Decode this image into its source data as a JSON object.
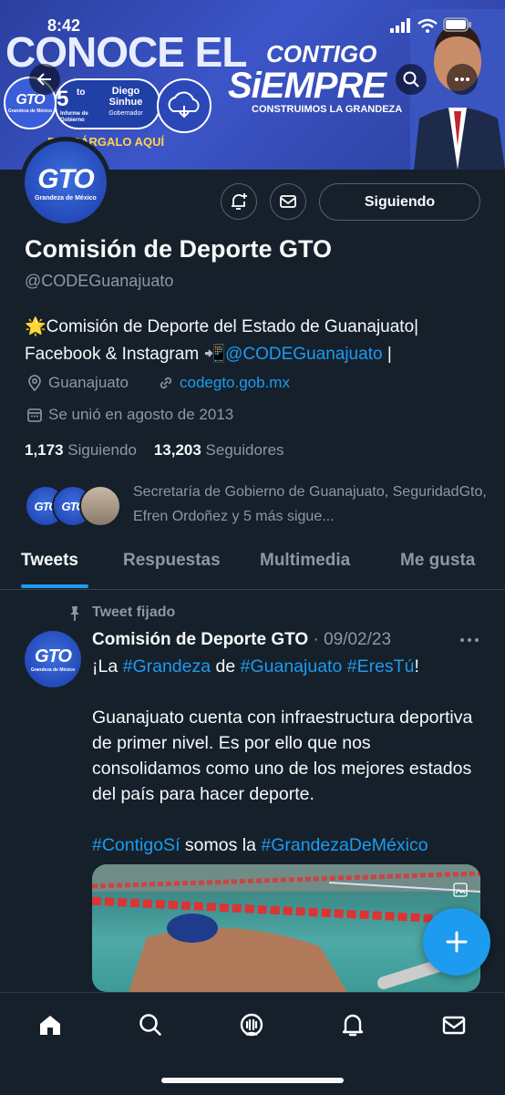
{
  "status_bar": {
    "time": "8:42"
  },
  "banner": {
    "headline": "CONOCE EL",
    "informe_number": "5",
    "informe_suffix": "to",
    "informe_label": "Informe de Gobierno",
    "informe_name": "Diego Sinhue",
    "informe_role": "Gobernador",
    "download_label": "DESCÁRGALO AQUÍ",
    "contigo": "CONTIGO",
    "siempre": "SiEMPRE",
    "construimos": "CONSTRUIMOS LA GRANDEZA",
    "logo_text": "GTO",
    "logo_sub": "Grandeza de México"
  },
  "profile": {
    "avatar_text": "GTO",
    "avatar_sub": "Grandeza de México",
    "follow_button": "Siguiendo",
    "name": "Comisión de Deporte GTO",
    "handle": "@CODEGuanajuato",
    "bio_emoji": "🌟",
    "bio_line1": "Comisión de Deporte del Estado de Guanajuato|",
    "bio_line2": "Facebook & Instagram ",
    "bio_emoji2": "📲",
    "bio_link": "@CODEGuanajuato",
    "bio_end": " |",
    "location": "Guanajuato",
    "website": "codegto.gob.mx",
    "joined": "Se unió en agosto de 2013",
    "following_count": "1,173",
    "following_label": "Siguiendo",
    "followers_count": "13,203",
    "followers_label": "Seguidores",
    "followed_by": "Secretaría de Gobierno de Guanajuato, SeguridadGto, Efren Ordoñez y 5 más sigue..."
  },
  "tabs": [
    {
      "label": "Tweets"
    },
    {
      "label": "Respuestas"
    },
    {
      "label": "Multimedia"
    },
    {
      "label": "Me gusta"
    }
  ],
  "tweet": {
    "pinned_label": "Tweet fijado",
    "author": "Comisión de Deporte GTO",
    "date": "· 09/02/23",
    "line1_a": "¡La ",
    "line1_tag1": "#Grandeza",
    "line1_b": " de ",
    "line1_tag2": "#Guanajuato",
    "line1_c": " ",
    "line1_tag3": "#EresTú",
    "line1_d": "!",
    "paragraph": "Guanajuato cuenta con infraestructura deportiva de primer nivel. Es por ello que nos consolidamos como uno de los mejores estados del país para hacer deporte.",
    "tag4": "#ContigoSí",
    "mid": " somos la ",
    "tag5": "#GrandezaDeMéxico"
  },
  "colors": {
    "background": "#15202b",
    "accent": "#1d9bf0",
    "muted": "#8b98a5"
  },
  "icons": [
    "back-arrow-icon",
    "search-icon",
    "more-icon",
    "bell-plus-icon",
    "mail-icon",
    "location-icon",
    "link-icon",
    "calendar-icon",
    "pin-icon",
    "compose-plus-icon",
    "home-icon",
    "explore-icon",
    "spaces-icon",
    "notifications-icon",
    "messages-icon"
  ]
}
